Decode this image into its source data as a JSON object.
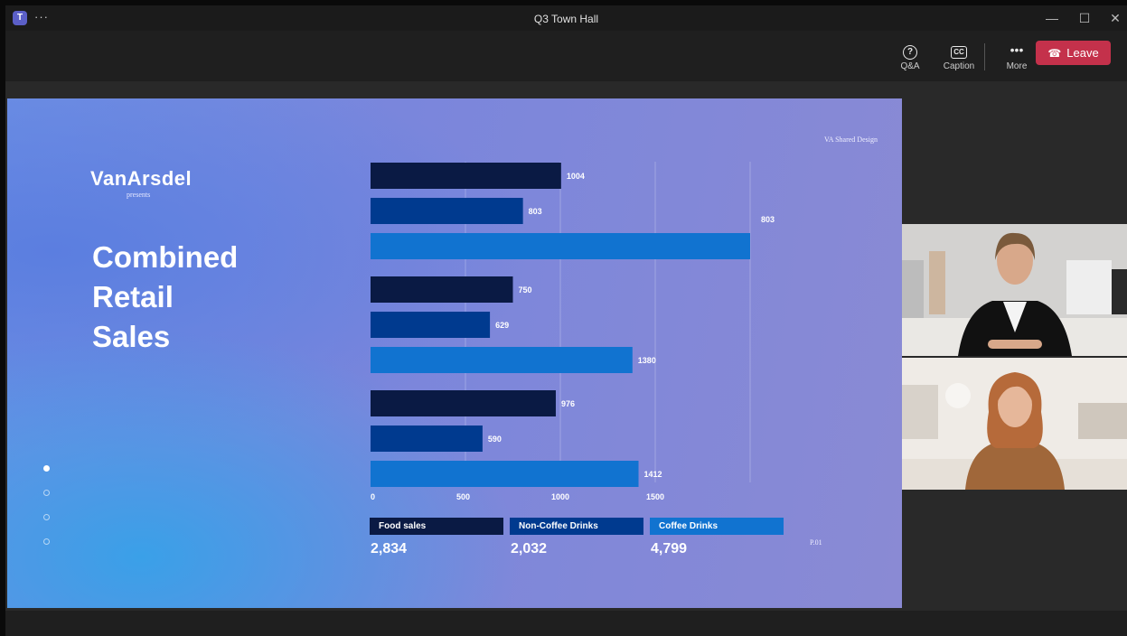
{
  "window": {
    "title": "Q3 Town Hall",
    "app_icon_label": "T",
    "overflow_label": "···"
  },
  "window_controls": {
    "minimize": "—",
    "maximize": "☐",
    "close": "✕"
  },
  "toolbar": {
    "qa_label": "Q&A",
    "caption_label": "Caption",
    "caption_icon_text": "CC",
    "more_label": "More",
    "leave_label": "Leave"
  },
  "slide": {
    "brand": "VanArsdel",
    "presents": "presents",
    "headline": [
      "Combined",
      "Retail",
      "Sales"
    ],
    "top_right_note": "VA Shared Design",
    "page_number": "P.01",
    "nav_dots": 4,
    "active_dot": 0
  },
  "chart_data": {
    "type": "bar",
    "orientation": "horizontal",
    "groups": [
      {
        "bars": [
          {
            "series": "Food sales",
            "value": 1004
          },
          {
            "series": "Non-Coffee Drinks",
            "value": 803
          },
          {
            "series": "Coffee Drinks",
            "value": 2000,
            "label": "803"
          }
        ]
      },
      {
        "bars": [
          {
            "series": "Food sales",
            "value": 750
          },
          {
            "series": "Non-Coffee Drinks",
            "value": 629
          },
          {
            "series": "Coffee Drinks",
            "value": 1380
          }
        ]
      },
      {
        "bars": [
          {
            "series": "Food sales",
            "value": 976
          },
          {
            "series": "Non-Coffee Drinks",
            "value": 590
          },
          {
            "series": "Coffee Drinks",
            "value": 1412
          }
        ]
      }
    ],
    "xlim": [
      0,
      2000
    ],
    "xticks": [
      0,
      500,
      1000,
      1500
    ],
    "series": [
      {
        "name": "Food sales",
        "color": "#0a1a44",
        "total": "2,834"
      },
      {
        "name": "Non-Coffee Drinks",
        "color": "#003a8f",
        "total": "2,032"
      },
      {
        "name": "Coffee Drinks",
        "color": "#1173d0",
        "total": "4,799"
      }
    ],
    "gridlines": true
  },
  "participants": [
    {
      "tile": "video-tile-1"
    },
    {
      "tile": "video-tile-2"
    }
  ]
}
